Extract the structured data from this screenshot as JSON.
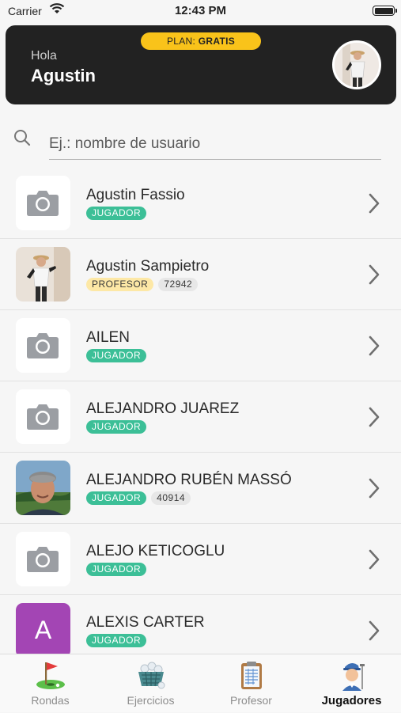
{
  "status_bar": {
    "carrier": "Carrier",
    "time": "12:43 PM"
  },
  "header": {
    "plan_prefix": "PLAN:",
    "plan_value": "GRATIS",
    "greeting": "Hola",
    "username": "Agustin"
  },
  "search": {
    "placeholder": "Ej.: nombre de usuario",
    "value": ""
  },
  "users": [
    {
      "name": "Agustin Fassio",
      "role": "JUGADOR",
      "code": "",
      "avatar": "camera-placeholder"
    },
    {
      "name": "Agustin Sampietro",
      "role": "PROFESOR",
      "code": "72942",
      "avatar": "photo"
    },
    {
      "name": "AILEN",
      "role": "JUGADOR",
      "code": "",
      "avatar": "camera-placeholder"
    },
    {
      "name": "ALEJANDRO JUAREZ",
      "role": "JUGADOR",
      "code": "",
      "avatar": "camera-placeholder"
    },
    {
      "name": "ALEJANDRO RUBÉN MASSÓ",
      "role": "JUGADOR",
      "code": "40914",
      "avatar": "photo"
    },
    {
      "name": "ALEJO KETICOGLU",
      "role": "JUGADOR",
      "code": "",
      "avatar": "camera-placeholder"
    },
    {
      "name": "ALEXIS CARTER",
      "role": "JUGADOR",
      "code": "",
      "avatar": "letter",
      "letter": "A"
    }
  ],
  "tabs": [
    {
      "label": "Rondas",
      "icon": "golf-flag-icon",
      "active": false
    },
    {
      "label": "Ejercicios",
      "icon": "ball-basket-icon",
      "active": false
    },
    {
      "label": "Profesor",
      "icon": "clipboard-icon",
      "active": false
    },
    {
      "label": "Jugadores",
      "icon": "golfer-icon",
      "active": true
    }
  ],
  "colors": {
    "header_bg": "#222222",
    "plan_badge": "#f9c31a",
    "jugador_tag": "#3cbf97",
    "profesor_tag": "#fde8a6",
    "letter_avatar": "#a345b4"
  }
}
